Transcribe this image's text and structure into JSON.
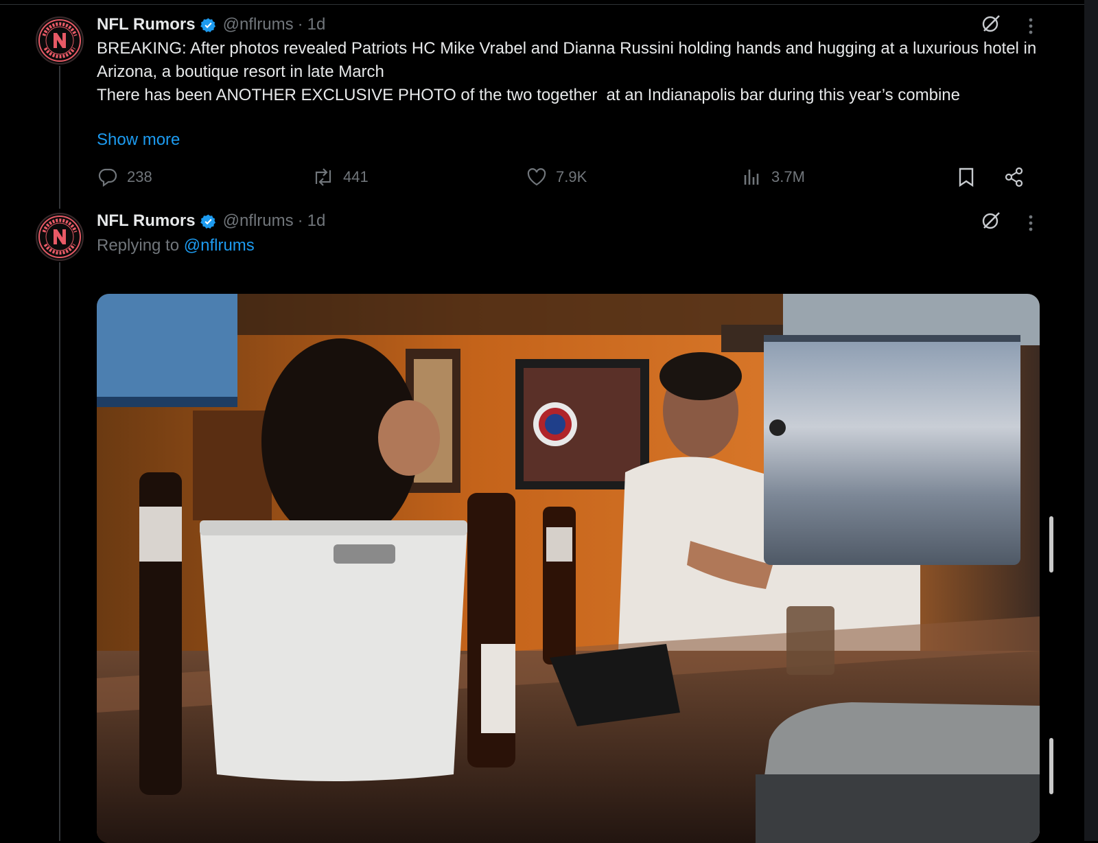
{
  "tweets": [
    {
      "name": "NFL Rumors",
      "handle": "@nflrums",
      "dot": "·",
      "time": "1d",
      "text_lines": [
        "BREAKING: After photos revealed Patriots HC Mike Vrabel and Dianna Russini holding hands and hugging at a luxurious hotel in Arizona, a boutique resort in late March",
        "",
        "There has been ANOTHER EXCLUSIVE PHOTO of the two together  at an Indianapolis bar during this year’s combine"
      ],
      "show_more": "Show more",
      "actions": {
        "replies": "238",
        "reposts": "441",
        "likes": "7.9K",
        "views": "3.7M"
      }
    },
    {
      "name": "NFL Rumors",
      "handle": "@nflrums",
      "dot": "·",
      "time": "1d",
      "replying_prefix": "Replying to",
      "replying_to": "@nflrums",
      "media": "photo"
    }
  ],
  "icons": {
    "grok": "grok-icon",
    "more": "more-icon",
    "verified": "verified-badge-icon",
    "reply": "reply-icon",
    "repost": "repost-icon",
    "like": "like-icon",
    "views": "views-icon",
    "bookmark": "bookmark-icon",
    "share": "share-icon"
  },
  "colors": {
    "background": "#000000",
    "text": "#e7e9ea",
    "muted": "#71767b",
    "link": "#1d9bf0",
    "avatar_accent": "#e85a66"
  }
}
